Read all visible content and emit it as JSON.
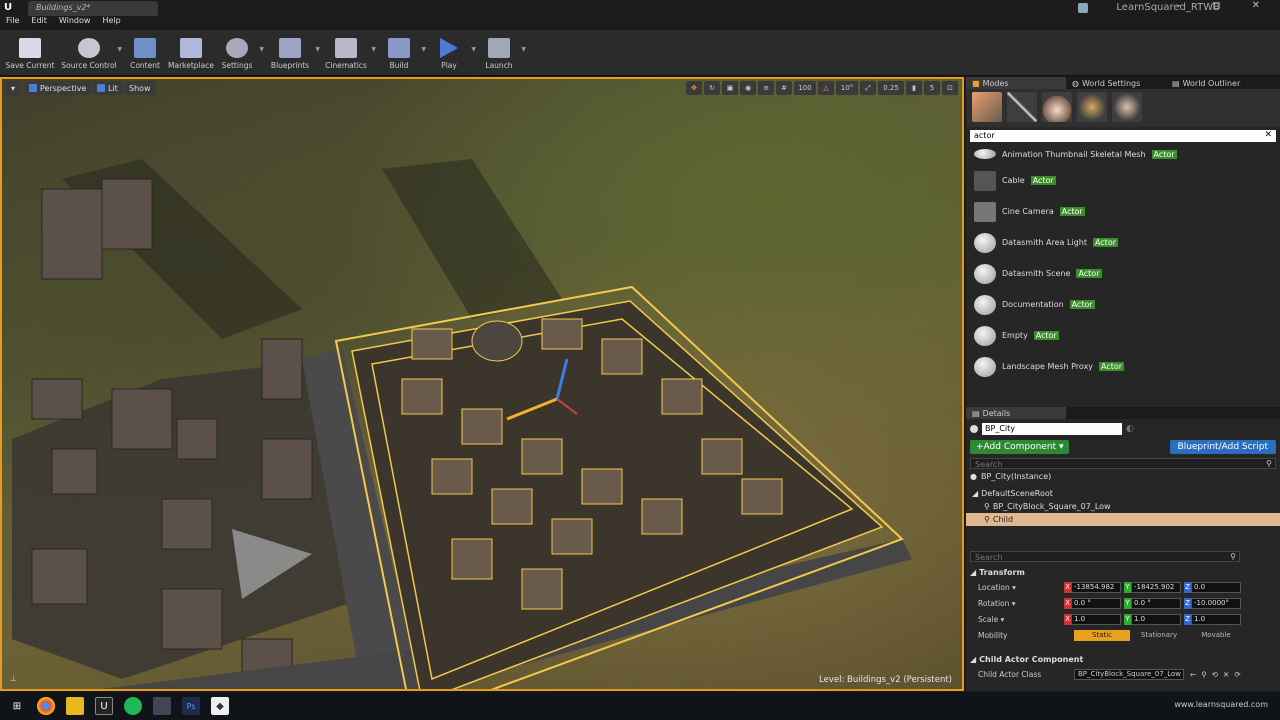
{
  "window": {
    "tab_title": "Buildings_v2*",
    "app_name": "LearnSquared_RTWB",
    "controls": "– ◻ ✕"
  },
  "menu": [
    "File",
    "Edit",
    "Window",
    "Help"
  ],
  "toolbar": [
    {
      "label": "Save Current",
      "icon": "save-icon",
      "color": "#d8d8e8"
    },
    {
      "label": "Source Control",
      "icon": "source-control-icon",
      "color": "#c7c7d0"
    },
    {
      "label": "Content",
      "icon": "content-icon",
      "color": "#6f8fc7"
    },
    {
      "label": "Marketplace",
      "icon": "marketplace-icon",
      "color": "#b0b8d8"
    },
    {
      "label": "Settings",
      "icon": "settings-gear-icon",
      "color": "#a8a8b8"
    },
    {
      "label": "Blueprints",
      "icon": "blueprints-icon",
      "color": "#9da4c4"
    },
    {
      "label": "Cinematics",
      "icon": "cinematics-icon",
      "color": "#b8b8c8"
    },
    {
      "label": "Build",
      "icon": "build-icon",
      "color": "#8a98c8"
    },
    {
      "label": "Play",
      "icon": "play-icon",
      "color": "#4d7ad8"
    },
    {
      "label": "Launch",
      "icon": "launch-icon",
      "color": "#a0a8b8"
    }
  ],
  "viewport": {
    "buttons": [
      "Perspective",
      "Lit",
      "Show"
    ],
    "right_values": [
      "100",
      "10°",
      "0.25",
      "5"
    ],
    "level_label": "Level:  Buildings_v2 (Persistent)"
  },
  "modes": {
    "tabs": [
      "Modes",
      "World Settings",
      "World Outliner"
    ],
    "search_value": "actor",
    "items": [
      {
        "name": "Animation Thumbnail Skeletal Mesh",
        "suffix": "Actor"
      },
      {
        "name": "Cable",
        "suffix": "Actor"
      },
      {
        "name": "Cine Camera",
        "suffix": "Actor"
      },
      {
        "name": "Datasmith Area Light",
        "suffix": "Actor"
      },
      {
        "name": "Datasmith Scene",
        "suffix": "Actor"
      },
      {
        "name": "Documentation",
        "suffix": "Actor"
      },
      {
        "name": "Empty",
        "suffix": "Actor"
      },
      {
        "name": "Landscape Mesh Proxy",
        "suffix": "Actor"
      }
    ]
  },
  "details": {
    "tab": "Details",
    "name_value": "BP_City",
    "add_component": "+Add Component ▾",
    "blueprint_btn": "Blueprint/Add Script",
    "search_placeholder": "Search",
    "instance": "BP_City(Instance)",
    "tree": [
      "DefaultSceneRoot",
      "BP_CityBlock_Square_07_Low",
      "Child"
    ],
    "transform_header": "Transform",
    "location_label": "Location ▾",
    "location": [
      "-13854.982",
      "-18425.902",
      "0.0"
    ],
    "rotation_label": "Rotation ▾",
    "rotation": [
      "0.0 °",
      "0.0 °",
      "-10.0000°"
    ],
    "scale_label": "Scale ▾",
    "scale": [
      "1.0",
      "1.0",
      "1.0"
    ],
    "mobility_label": "Mobility",
    "mobility": [
      "Static",
      "Stationary",
      "Movable"
    ],
    "child_header": "Child Actor Component",
    "child_class_label": "Child Actor Class",
    "child_class_value": "BP_CityBlock_Square_07_Low ▾"
  },
  "taskbar": {
    "right_text": "www.learnsquared.com"
  },
  "colors": {
    "accent_orange": "#e79b1c",
    "selection_yellow": "#f2c94c",
    "highlight_green": "#3c8e2a",
    "blue_button": "#2a6fbf"
  }
}
